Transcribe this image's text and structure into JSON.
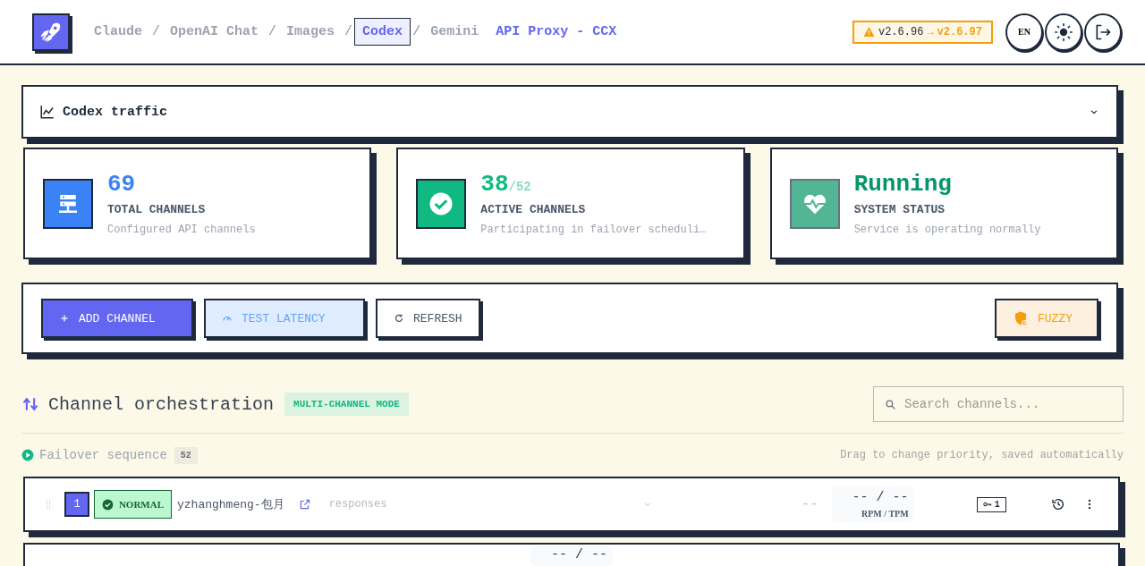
{
  "header": {
    "breadcrumbs": [
      {
        "label": "Claude",
        "selected": false
      },
      {
        "label": "OpenAI Chat",
        "selected": false
      },
      {
        "label": "Images",
        "selected": false
      },
      {
        "label": "Codex",
        "selected": true
      },
      {
        "label": "Gemini",
        "selected": false
      }
    ],
    "separator": "/",
    "app_title": "API Proxy - CCX",
    "update": {
      "current": "v2.6.96",
      "arrow": "→",
      "latest": "v2.6.97"
    },
    "language": "EN"
  },
  "traffic_panel": {
    "title": "Codex traffic",
    "expanded": false
  },
  "stats": [
    {
      "kind": "total",
      "value": "69",
      "label": "TOTAL CHANNELS",
      "description": "Configured API channels",
      "color": "#3b82f6"
    },
    {
      "kind": "active",
      "value": "38",
      "total": "/52",
      "label": "ACTIVE CHANNELS",
      "description": "Participating in failover scheduli…",
      "color": "#10b981"
    },
    {
      "kind": "status",
      "value": "Running",
      "label": "SYSTEM STATUS",
      "description": "Service is operating normally",
      "color": "#52b594"
    }
  ],
  "actions": [
    {
      "kind": "primary",
      "label": "ADD CHANNEL"
    },
    {
      "kind": "latency",
      "label": "TEST LATENCY"
    },
    {
      "kind": "plain",
      "label": "REFRESH"
    }
  ],
  "fuzzy_button": {
    "label": "FUZZY"
  },
  "orchestration": {
    "title": "Channel orchestration",
    "mode_badge": "MULTI-CHANNEL MODE",
    "search": {
      "placeholder": "Search channels..."
    },
    "sequence_title": "Failover sequence",
    "sequence_count": "52",
    "hint": "Drag to change priority, saved automatically",
    "rows": [
      {
        "index": "1",
        "status": "NORMAL",
        "name": "yzhanghmeng-包月",
        "service_type": "responses",
        "latency": "--",
        "rpm_tpm": "-- / --",
        "rpm_label": "RPM / TPM",
        "keys": "1"
      },
      {
        "rpm_tpm": "-- / --"
      }
    ]
  }
}
